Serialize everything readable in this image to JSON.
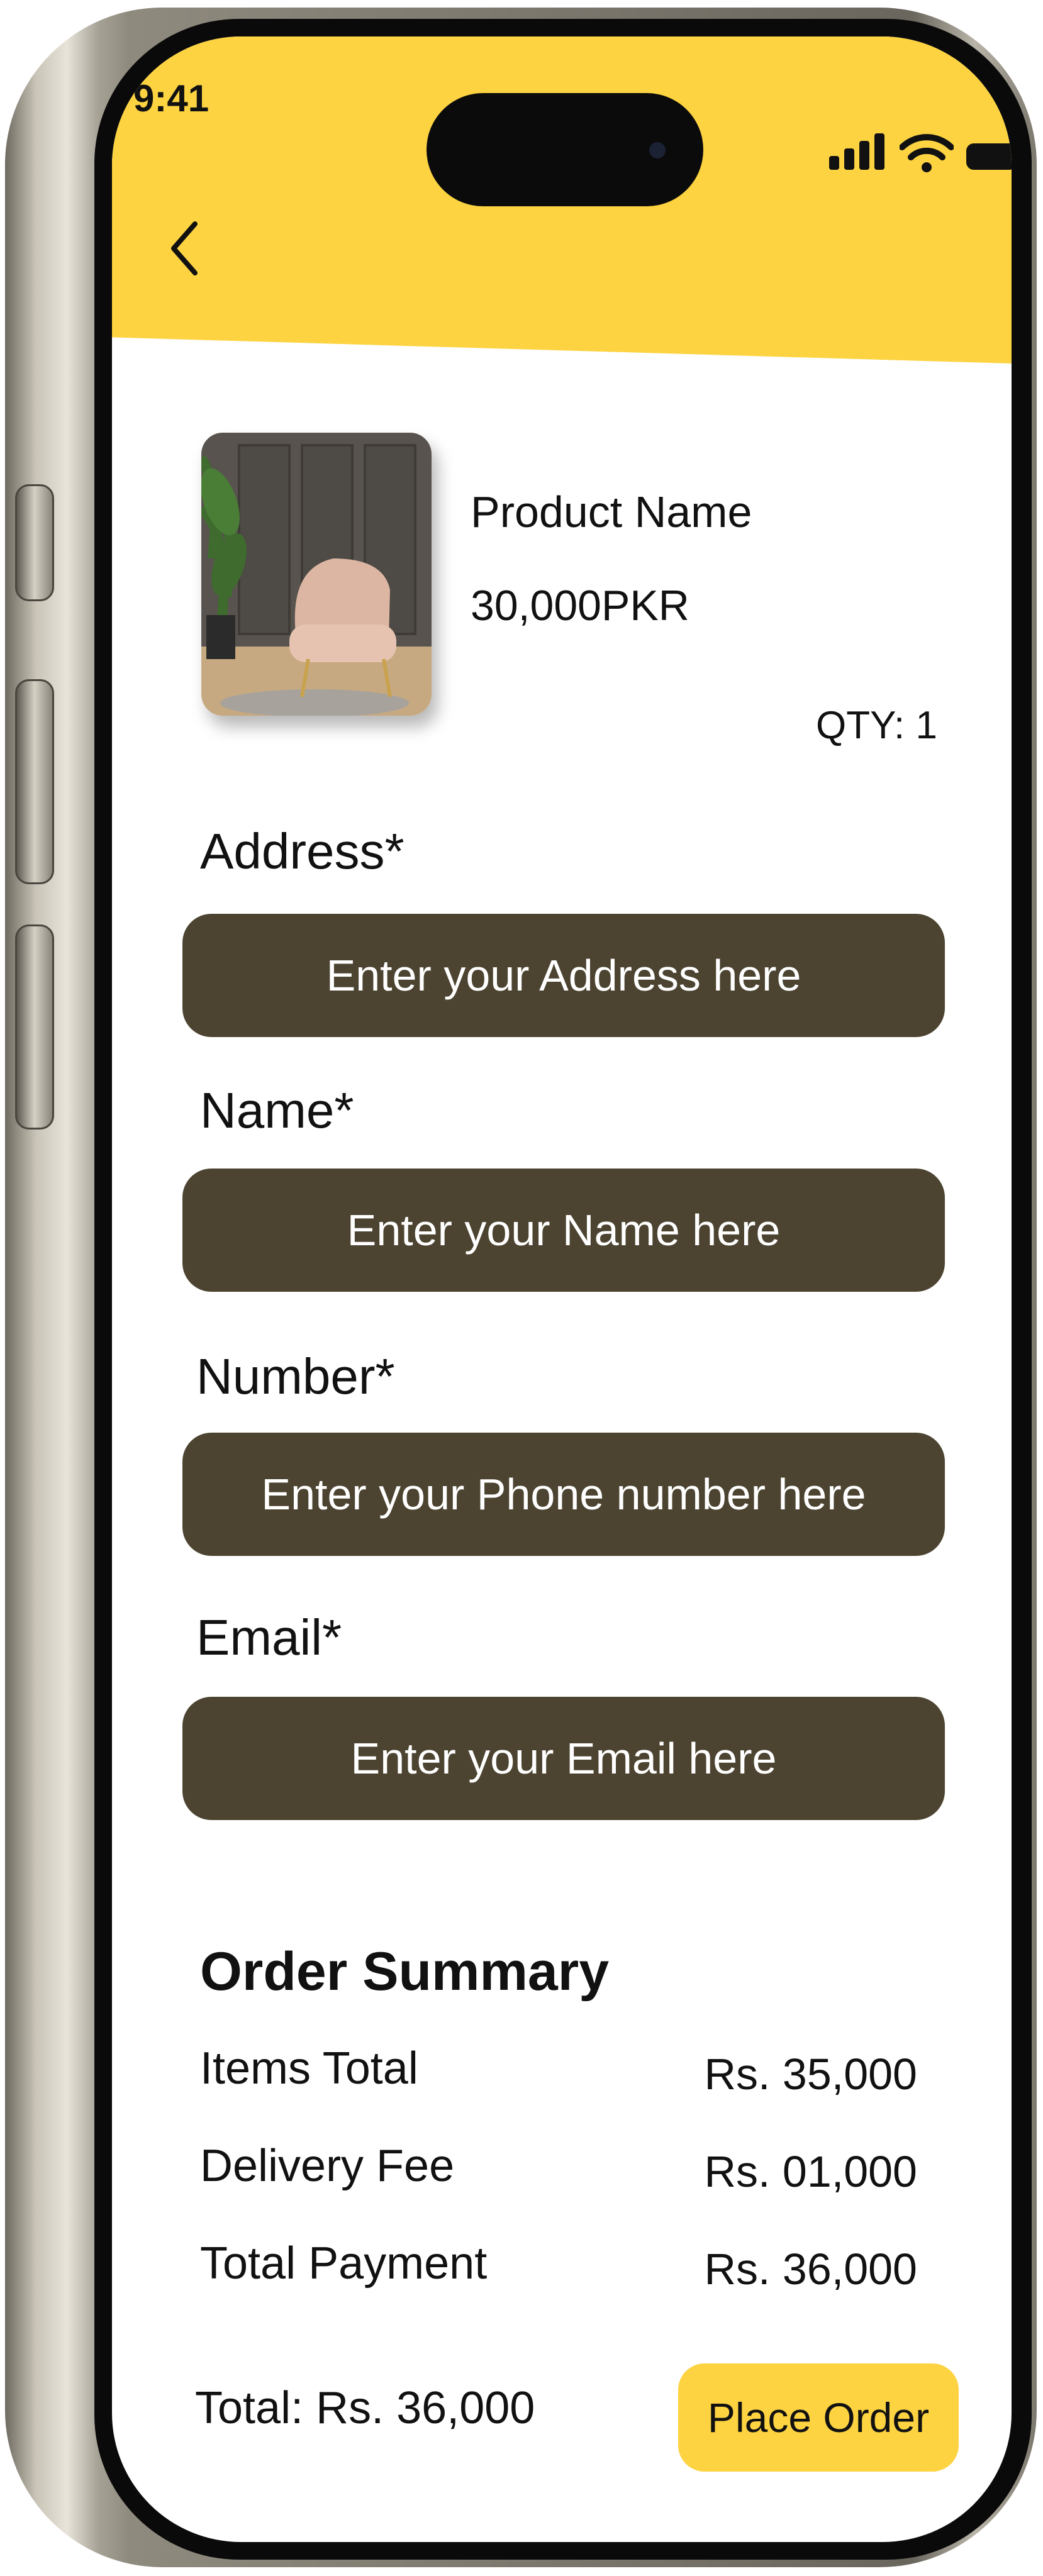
{
  "status_bar": {
    "time": "9:41"
  },
  "product": {
    "name": "Product Name",
    "price": "30,000PKR",
    "qty": "QTY: 1",
    "image_icon": "armchair-photo"
  },
  "form": {
    "address": {
      "label": "Address*",
      "placeholder": "Enter your Address here"
    },
    "name": {
      "label": "Name*",
      "placeholder": "Enter your Name here"
    },
    "number": {
      "label": "Number*",
      "placeholder": "Enter your Phone number here"
    },
    "email": {
      "label": "Email*",
      "placeholder": "Enter your Email here"
    }
  },
  "summary": {
    "title": "Order Summary",
    "rows": [
      {
        "label": "Items Total",
        "value": "Rs. 35,000"
      },
      {
        "label": "Delivery Fee",
        "value": "Rs. 01,000"
      },
      {
        "label": "Total Payment",
        "value": "Rs. 36,000"
      }
    ]
  },
  "footer": {
    "total": "Total:  Rs. 36,000",
    "place_order_label": "Place Order"
  },
  "colors": {
    "accent_yellow": "#fdd341",
    "input_background": "#4c4431",
    "text": "#111111"
  }
}
